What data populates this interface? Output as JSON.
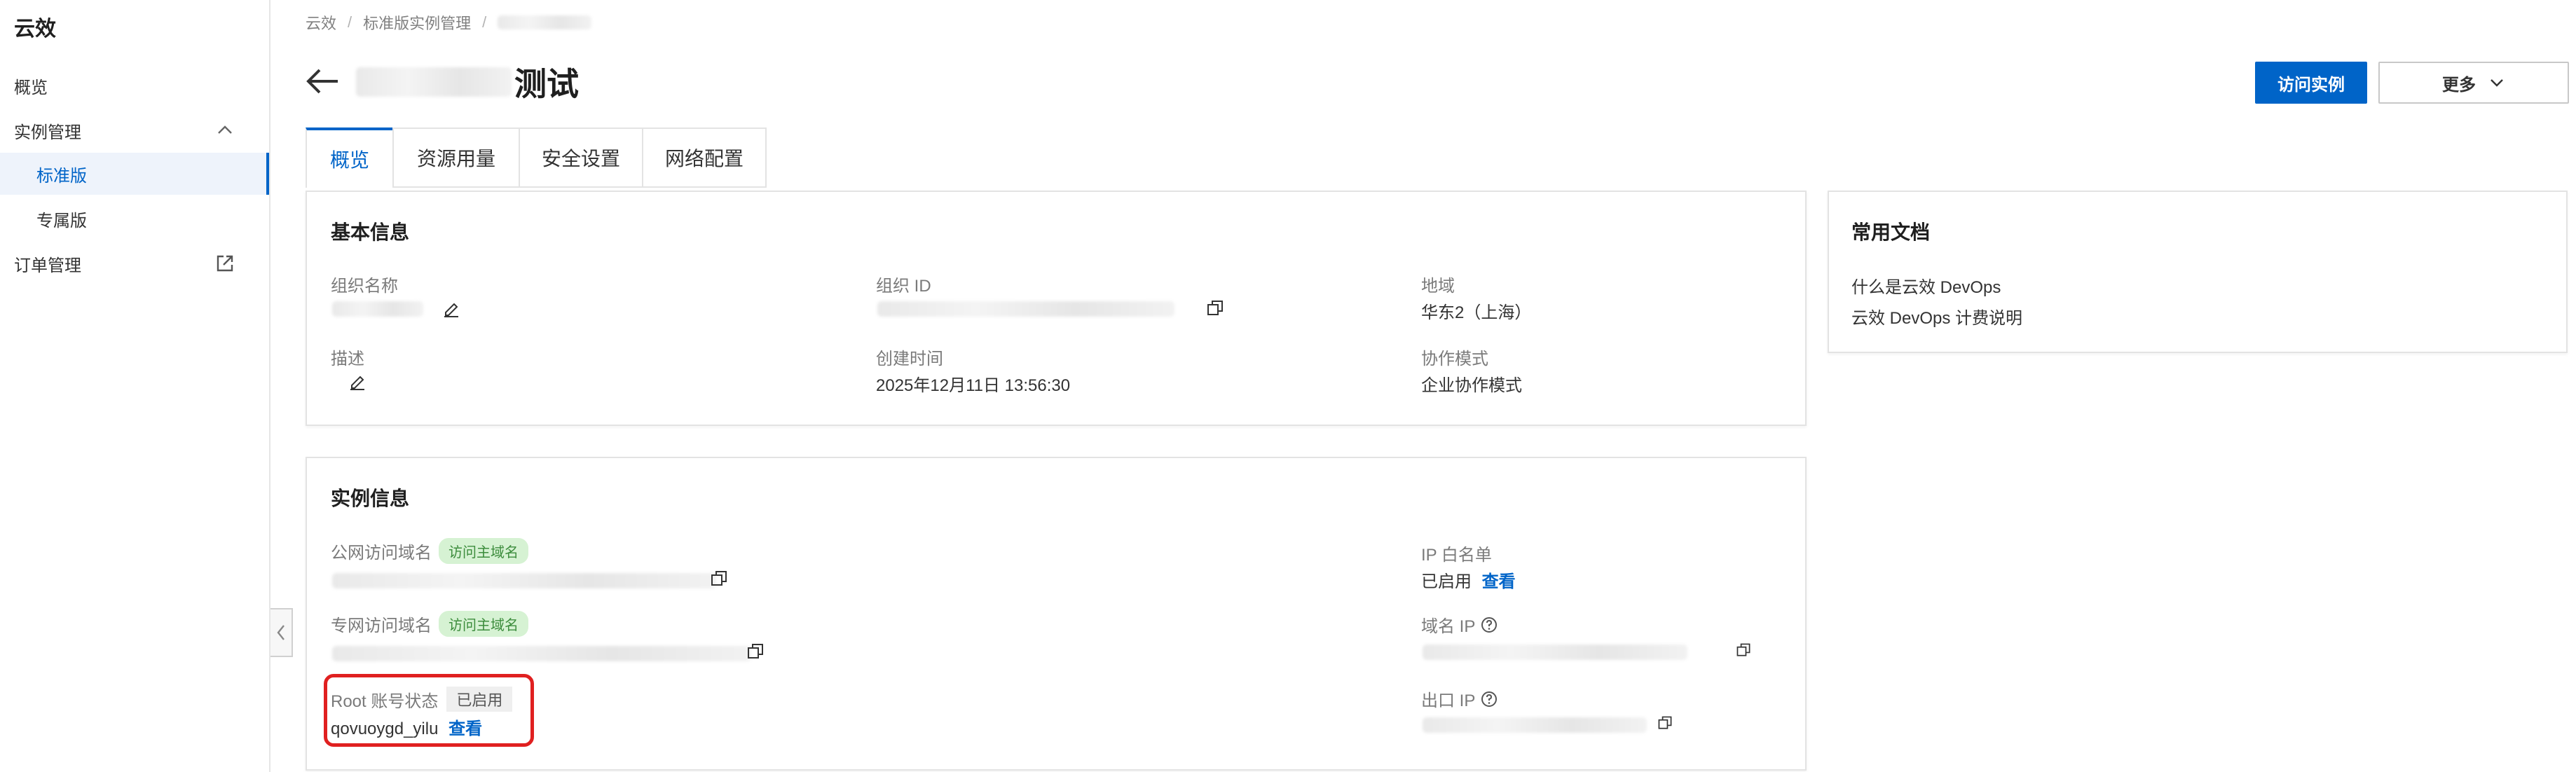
{
  "sidebar": {
    "brand": "云效",
    "items": [
      {
        "label": "概览"
      },
      {
        "label": "实例管理"
      },
      {
        "label": "标准版"
      },
      {
        "label": "专属版"
      },
      {
        "label": "订单管理"
      }
    ]
  },
  "breadcrumb": {
    "items": [
      "云效",
      "标准版实例管理"
    ]
  },
  "header": {
    "title_suffix": "测试",
    "visit_button": "访问实例",
    "more_button": "更多"
  },
  "tabs": [
    "概览",
    "资源用量",
    "安全设置",
    "网络配置"
  ],
  "basic_info": {
    "title": "基本信息",
    "org_name_label": "组织名称",
    "org_id_label": "组织 ID",
    "region_label": "地域",
    "region_value": "华东2（上海）",
    "desc_label": "描述",
    "created_label": "创建时间",
    "created_value": "2025年12月11日 13:56:30",
    "collab_label": "协作模式",
    "collab_value": "企业协作模式"
  },
  "instance_info": {
    "title": "实例信息",
    "public_domain_label": "公网访问域名",
    "public_domain_tag": "访问主域名",
    "private_domain_label": "专网访问域名",
    "private_domain_tag": "访问主域名",
    "root_status_label": "Root 账号状态",
    "root_status_tag": "已启用",
    "root_account": "qovuoygd_yilu",
    "root_view_link": "查看",
    "ip_whitelist_label": "IP 白名单",
    "ip_whitelist_status": "已启用",
    "ip_whitelist_link": "查看",
    "domain_ip_label": "域名 IP",
    "egress_ip_label": "出口 IP"
  },
  "docs": {
    "title": "常用文档",
    "links": [
      "什么是云效 DevOps",
      "云效 DevOps 计费说明"
    ]
  },
  "colors": {
    "primary": "#0064c8",
    "highlight": "#e02020",
    "tag_green_bg": "#d6f2d3"
  }
}
